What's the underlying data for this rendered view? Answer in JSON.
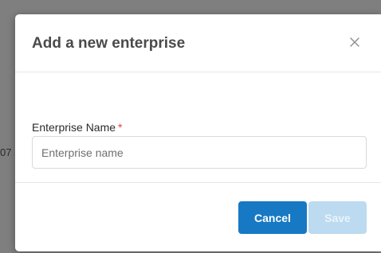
{
  "backdrop": {
    "glimpse_text": "07"
  },
  "modal": {
    "title": "Add a new enterprise",
    "close_icon": "close-icon",
    "field": {
      "label": "Enterprise Name",
      "required_mark": "*",
      "value": "",
      "placeholder": "Enterprise name"
    },
    "buttons": {
      "cancel_label": "Cancel",
      "save_label": "Save"
    }
  },
  "colors": {
    "primary": "#1779c4",
    "primary_disabled": "#bcdaf0",
    "required": "#e03e3e"
  }
}
